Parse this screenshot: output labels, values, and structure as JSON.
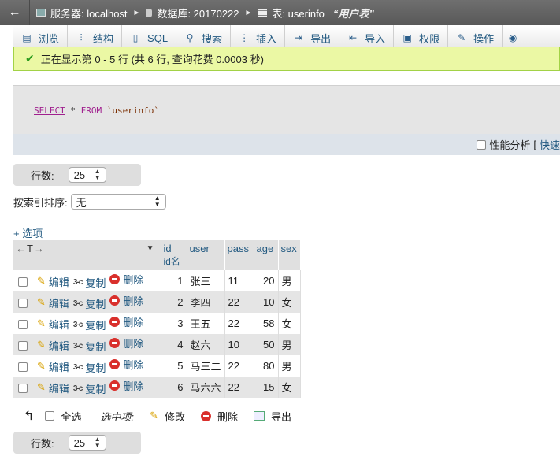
{
  "breadcrumb": {
    "back": "←",
    "server": "服务器: localhost",
    "database": "数据库: 20170222",
    "table": "表: userinfo",
    "table_comment": "“用户表”"
  },
  "tabs": [
    {
      "label": "浏览",
      "icon": "browse-icon"
    },
    {
      "label": "结构",
      "icon": "structure-icon"
    },
    {
      "label": "SQL",
      "icon": "sql-icon"
    },
    {
      "label": "搜索",
      "icon": "search-icon"
    },
    {
      "label": "插入",
      "icon": "insert-icon"
    },
    {
      "label": "导出",
      "icon": "export-icon"
    },
    {
      "label": "导入",
      "icon": "import-icon"
    },
    {
      "label": "权限",
      "icon": "privileges-icon"
    },
    {
      "label": "操作",
      "icon": "operations-icon"
    }
  ],
  "message": "正在显示第 0 - 5 行 (共 6 行, 查询花费 0.0003 秒)",
  "sql": {
    "select": "SELECT",
    "star": "*",
    "from": "FROM",
    "table": "`userinfo`"
  },
  "sql_footer": {
    "profiling": "性能分析",
    "bracket": "[",
    "quick": "快速"
  },
  "rows_nav": {
    "label": "行数:",
    "value": "25"
  },
  "sort": {
    "label": "按索引排序:",
    "value": "无"
  },
  "options_link": "+ 选项",
  "table": {
    "columns": [
      {
        "name": "id",
        "comment": "id名"
      },
      {
        "name": "user"
      },
      {
        "name": "pass"
      },
      {
        "name": "age"
      },
      {
        "name": "sex"
      }
    ],
    "actions": {
      "edit": "编辑",
      "copy": "复制",
      "delete": "删除"
    },
    "rows": [
      {
        "id": "1",
        "user": "张三",
        "pass": "11",
        "age": "20",
        "sex": "男"
      },
      {
        "id": "2",
        "user": "李四",
        "pass": "22",
        "age": "10",
        "sex": "女"
      },
      {
        "id": "3",
        "user": "王五",
        "pass": "22",
        "age": "58",
        "sex": "女"
      },
      {
        "id": "4",
        "user": "赵六",
        "pass": "10",
        "age": "50",
        "sex": "男"
      },
      {
        "id": "5",
        "user": "马三二",
        "pass": "22",
        "age": "80",
        "sex": "男"
      },
      {
        "id": "6",
        "user": "马六六",
        "pass": "22",
        "age": "15",
        "sex": "女"
      }
    ]
  },
  "bulk": {
    "select_all": "全选",
    "with_selected": "选中项:",
    "edit": "修改",
    "delete": "删除",
    "export": "导出"
  },
  "rows_nav_bottom": {
    "label": "行数:",
    "value": "25"
  }
}
